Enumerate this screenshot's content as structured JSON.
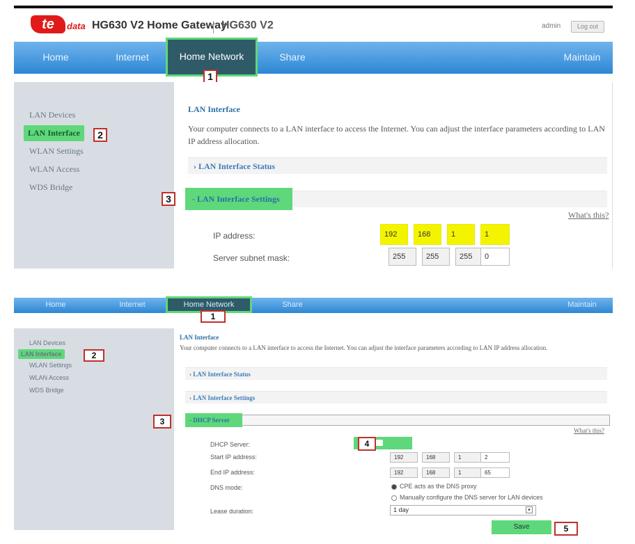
{
  "panel1": {
    "brand": {
      "logo": "te",
      "logo_suffix": "data",
      "title": "HG630 V2 Home Gateway",
      "model": "HG630 V2"
    },
    "user": {
      "name": "admin",
      "logout": "Log out"
    },
    "nav": [
      "Home",
      "Internet",
      "Home Network",
      "Share",
      "Maintain"
    ],
    "sidebar": [
      "LAN Devices",
      "LAN Interface",
      "WLAN Settings",
      "WLAN Access",
      "WDS Bridge"
    ],
    "main": {
      "title": "LAN Interface",
      "description": "Your computer connects to a LAN interface to access the Internet. You can adjust the interface parameters according to LAN IP address allocation.",
      "status_section": "LAN Interface Status",
      "settings_section": "LAN Interface Settings",
      "whats_this": "What's this?",
      "ip_label": "IP address:",
      "ip": [
        "192",
        "168",
        "1",
        "1"
      ],
      "mask_label": "Server subnet mask:",
      "mask": [
        "255",
        "255",
        "255",
        "0"
      ]
    },
    "steps": [
      "1",
      "2",
      "3"
    ]
  },
  "panel2": {
    "nav": [
      "Home",
      "Internet",
      "Home Network",
      "Share",
      "Maintain"
    ],
    "sidebar": [
      "LAN Devices",
      "LAN Interface",
      "WLAN Settings",
      "WLAN Access",
      "WDS Bridge"
    ],
    "main": {
      "title": "LAN Interface",
      "description": "Your computer connects to a LAN interface to access the Internet. You can adjust the interface parameters according to LAN IP address allocation.",
      "status_section": "LAN Interface Status",
      "settings_section": "LAN Interface Settings",
      "dhcp_section": "DHCP Server",
      "whats_this": "What's this?",
      "dhcp_label": "DHCP Server:",
      "start_label": "Start IP address:",
      "start_ip": [
        "192",
        "168",
        "1",
        "2"
      ],
      "end_label": "End IP address:",
      "end_ip": [
        "192",
        "168",
        "1",
        "65"
      ],
      "dns_label": "DNS mode:",
      "dns_option1": "CPE acts as the DNS proxy",
      "dns_option2": "Manually configure the DNS server for LAN devices",
      "lease_label": "Lease duration:",
      "lease_value": "1 day",
      "save": "Save"
    },
    "steps": [
      "1",
      "2",
      "3",
      "4",
      "5"
    ]
  },
  "colors": {
    "highlight_green": "#5ed87a",
    "annotation_red": "#c0302a",
    "nav_blue": "#2d87d4",
    "ip_highlight": "#f4f400"
  }
}
